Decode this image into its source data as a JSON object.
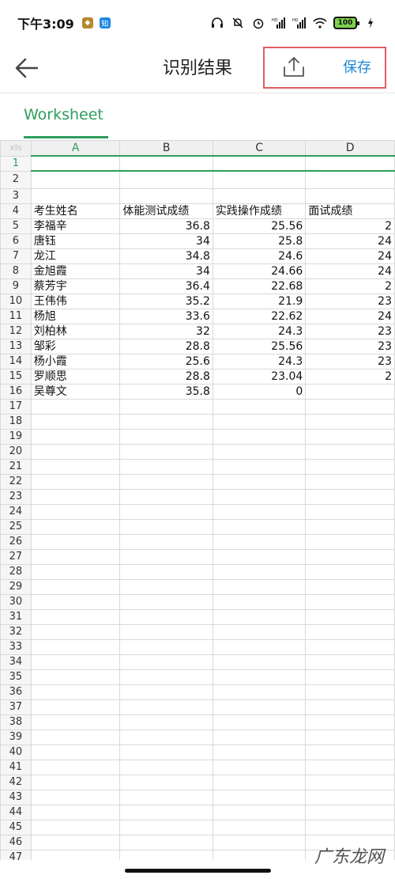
{
  "status_bar": {
    "time": "下午3:09",
    "app_badge": "知",
    "battery": "100",
    "icons": [
      "headphones-icon",
      "bell-muted-icon",
      "alarm-icon",
      "hd-signal-icon",
      "hd-signal-icon",
      "wifi-icon",
      "battery-icon",
      "charging-icon"
    ]
  },
  "toolbar": {
    "title": "识别结果",
    "save_label": "保存",
    "back_icon": "arrow-left-icon",
    "share_icon": "share-upload-icon",
    "highlight_color": "#e05c61"
  },
  "tabs": [
    {
      "label": "Worksheet",
      "active": true
    }
  ],
  "sheet": {
    "corner_label": "xls",
    "columns": [
      "A",
      "B",
      "C",
      "D"
    ],
    "header_row": [
      "考生姓名",
      "体能测试成绩",
      "实践操作成绩",
      "面试成绩"
    ],
    "rows": [
      [
        "李福辛",
        "36.8",
        "25.56",
        "2"
      ],
      [
        "唐钰",
        "34",
        "25.8",
        "24"
      ],
      [
        "龙江",
        "34.8",
        "24.6",
        "24"
      ],
      [
        "金旭霞",
        "34",
        "24.66",
        "24"
      ],
      [
        "蔡芳宇",
        "36.4",
        "22.68",
        "2"
      ],
      [
        "王伟伟",
        "35.2",
        "21.9",
        "23"
      ],
      [
        "杨旭",
        "33.6",
        "22.62",
        "24"
      ],
      [
        "刘柏林",
        "32",
        "24.3",
        "23"
      ],
      [
        "邹彩",
        "28.8",
        "25.56",
        "23"
      ],
      [
        "杨小霞",
        "25.6",
        "24.3",
        "23"
      ],
      [
        "罗顺思",
        "28.8",
        "23.04",
        "2"
      ],
      [
        "吴尊文",
        "35.8",
        "0",
        ""
      ]
    ],
    "total_rows": 47
  },
  "accent_color": "#2e9d5c",
  "watermark": "广东龙网"
}
